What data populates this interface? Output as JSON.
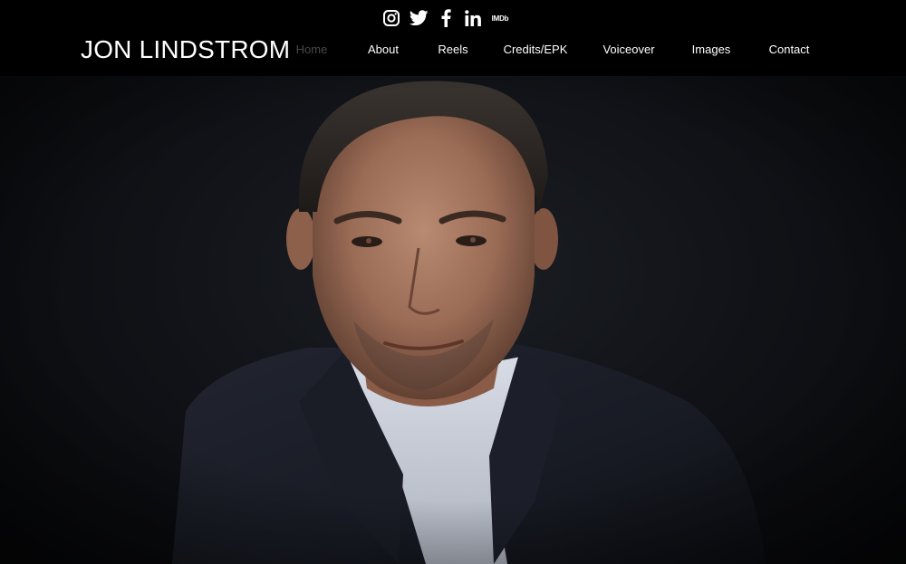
{
  "site": {
    "title": "JON LINDSTROM"
  },
  "social": [
    {
      "name": "instagram-icon"
    },
    {
      "name": "twitter-icon"
    },
    {
      "name": "facebook-icon"
    },
    {
      "name": "linkedin-icon"
    },
    {
      "name": "imdb-icon",
      "label": "IMDb"
    }
  ],
  "nav": {
    "items": [
      {
        "label": "Home",
        "active": true
      },
      {
        "label": "About"
      },
      {
        "label": "Reels"
      },
      {
        "label": "Credits/EPK"
      },
      {
        "label": "Voiceover"
      },
      {
        "label": "Images"
      },
      {
        "label": "Contact"
      }
    ]
  },
  "colors": {
    "background": "#000000",
    "nav_text": "#ffffff",
    "nav_active": "#4a4a4a"
  }
}
